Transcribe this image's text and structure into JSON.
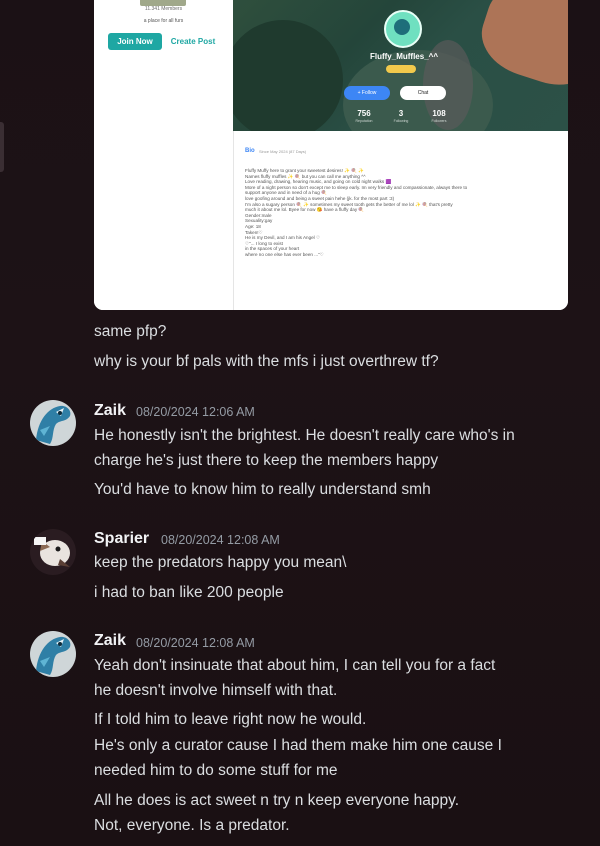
{
  "embed": {
    "members_text": "11.341 Members",
    "tagline": "a place for all furs",
    "join_label": "Join Now",
    "create_label": "Create Post",
    "profile_name": "Fluffy_Muffles_^^",
    "follow_label": "+ Follow",
    "chat_label": "Chat",
    "stats": [
      {
        "num": "756",
        "label": "Reputation"
      },
      {
        "num": "3",
        "label": "Following"
      },
      {
        "num": "108",
        "label": "Followers"
      }
    ],
    "bio_title": "Bio",
    "bio_since": "Since May 2024 (87 Days)",
    "bio_lines": [
      "Fluffy Muffy here to grant your sweetest desires! ✨ 🍭 ✨",
      "Names fluffy muffles ✨ 🍭 but you can call me anything ^^",
      "Love reading, drawing, hearing music, and going on cold night walks 🟪",
      "More of a night person so don't except me to sleep early. Im very friendly and compassionate, always there to",
      "support anyone and in need of a hug 🍭",
      "love goofing around and being a sweet pain hehe (jk. for the most part :3)",
      "I'm also a sugary person 🍭 ✨ sometimes my sweet tooth gets the better of me lol ✨ 🍭 that's pretty",
      "much it about me lol. Byee for now 😘 have a fluffy day 🍭",
      "Gender:male",
      "Sexuality:gay",
      "Age: 18",
      "Taken!♡",
      "He is my Devil, and I am his Angel ♡",
      "♡\"... I long to exist",
      "in the spaces of your heart",
      "where no one else has ever been ...\"♡"
    ]
  },
  "messages": {
    "pre": [
      "same pfp?",
      "why is your bf pals with the mfs i just overthrew tf?"
    ],
    "m1": {
      "author": "Zaik",
      "time": "08/20/2024 12:06 AM",
      "lines": [
        "He honestly isn't the brightest. He doesn't really care who's in",
        "charge he's just there to keep the members happy",
        "You'd have to know him to really understand smh"
      ]
    },
    "m2": {
      "author": "Sparier",
      "time": "08/20/2024 12:08 AM",
      "lines": [
        "keep the predators happy you mean\\",
        "i had to ban like 200 people"
      ]
    },
    "m3": {
      "author": "Zaik",
      "time": "08/20/2024 12:08 AM",
      "lines": [
        "Yeah don't insinuate that about him, I can tell you for a fact",
        "he doesn't involve himself with that.",
        "If I told him to leave right now he would.",
        "He's only a curator cause I had them make him one cause I",
        "needed him to do some stuff for me",
        "All he does is act sweet n try n keep everyone happy.",
        "Not, everyone. Is a predator."
      ]
    }
  }
}
